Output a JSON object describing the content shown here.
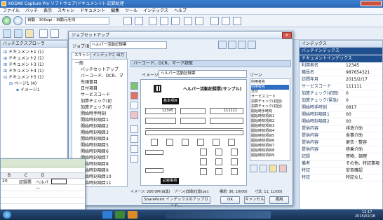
{
  "window": {
    "title": "KODAK Capture Pro ソフトウェア(ドキュメント)- 記録処理"
  },
  "menu": [
    "ファイル",
    "バッチ",
    "表示",
    "スキャン",
    "ドキュメント",
    "編集",
    "ツール",
    "インデックス",
    "ヘルプ"
  ],
  "toolbar": {
    "profile": "自動 - 300dpi - 自動元を向",
    "zoom_percent": ""
  },
  "left_panel": {
    "title": "バッチエクスプローラ",
    "items": [
      "ドキュメント1 (1)",
      "ドキュメント2 (1)",
      "ドキュメント3 (1)",
      "ドキュメント4 (1)",
      "ドキュメント5 (1)",
      "ページ1 (4)",
      "イメージ1"
    ]
  },
  "dialog": {
    "title": "ジョブセットアップ",
    "job_label": "ジョブ(B):",
    "job_value": "ヘルパー活動記録票",
    "tabs": [
      "スキャン",
      "インデックス",
      "出力"
    ],
    "tree": [
      "一般",
      "バッチセットアップ",
      "バーコード、OCR、マ",
      "先頭書目",
      "日付項目",
      "サービスコード",
      "加算チェック(初",
      "加算チェック(初",
      "開始時手時刻",
      "開始時刻項目1",
      "開始時刻項目2",
      "開始時刻項目3",
      "開始時刻項目4",
      "開始時刻項目5",
      "開始時刻項目6",
      "開始時刻項目7",
      "開始時刻項目8",
      "開始時刻項目9",
      "開始時刻項目10",
      "開始時刻項目11"
    ],
    "section_title": "バーコード、OCR、マーク読取",
    "image_label": "イメージ:",
    "image_value": "ヘルパー活動記録票",
    "zone_label": "ゾーン",
    "zone_items": [
      "利用者名",
      "利用者名",
      "日付",
      "サービスコード",
      "加算チェック(初回)",
      "加算チェック(初回)",
      "開始時手時刻",
      "開始時刻項目1",
      "開始時刻項目2",
      "開始時刻項目3",
      "開始時刻項目4",
      "開始時刻項目5",
      "開始時刻項目6",
      "開始時刻項目7",
      "開始時刻項目8",
      "開始時刻項目9"
    ],
    "form_title": "ヘルパー活動記録票(サンプル)",
    "form_sub_title": "基本項目",
    "form_sub_title2": "記録事項",
    "form_fields": {
      "id_value": "12345",
      "code_value": "111111"
    },
    "status": {
      "image": "イメージ: 200 DPI(白黒)",
      "zone": "ゾーン(詳細)位置(px):",
      "position": "構想: 36, 10(00)",
      "size": "寸法: 11, 11(00)"
    },
    "buttons": {
      "sharepoint": "SharePoint インデックスのアップロード...",
      "ok": "OK",
      "cancel": "キャンセル",
      "apply": "適用"
    }
  },
  "right_panel": {
    "title": "インデックス",
    "section1": "バッチインデックス",
    "section2": "ドキュメントインデックス",
    "rows": [
      {
        "k": "利用者名",
        "v": "12345"
      },
      {
        "k": "職員名",
        "v": "987654321"
      },
      {
        "k": "訪問年月",
        "v": "2015/2/17"
      },
      {
        "k": "サービスコード",
        "v": "111111"
      },
      {
        "k": "加算チェック(初回)",
        "v": "0"
      },
      {
        "k": "加算チェック(緊急)",
        "v": "0"
      },
      {
        "k": "開始時手時刻",
        "v": "0817"
      },
      {
        "k": "開始時刻項目1",
        "v": "00"
      },
      {
        "k": "開始時刻項目2",
        "v": "00"
      },
      {
        "k": "提供内容",
        "v": "排泄介助"
      },
      {
        "k": "提供内容",
        "v": "食事介助"
      },
      {
        "k": "提供内容",
        "v": "更衣・整容"
      },
      {
        "k": "提供内容",
        "v": "移乗介助"
      },
      {
        "k": "記録",
        "v": "買物、調理"
      },
      {
        "k": "備考",
        "v": "その他、特記事項"
      },
      {
        "k": "特記",
        "v": "安否確認"
      },
      {
        "k": "特記",
        "v": "特記なし"
      }
    ]
  },
  "spreadsheet": {
    "columns": [
      "B",
      "C",
      "D"
    ],
    "cells": [
      "20",
      "記録票",
      "ヘルパー"
    ]
  },
  "taskbar": {
    "time": "12:17",
    "date": "2015/02/18"
  },
  "colors": {
    "title_bar": "#2c68b4",
    "dialog_bg": "#e9eff7",
    "header_blue": "#1f4f8e",
    "taskbar": "#16304f"
  }
}
